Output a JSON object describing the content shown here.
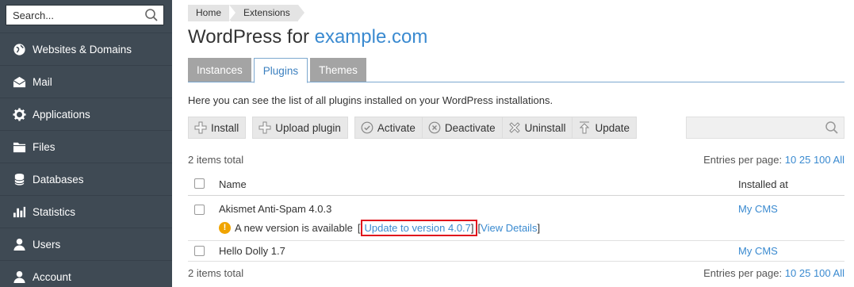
{
  "sidebar": {
    "search_placeholder": "Search...",
    "items": [
      {
        "label": "Websites & Domains",
        "icon": "globe-icon"
      },
      {
        "label": "Mail",
        "icon": "mail-icon"
      },
      {
        "label": "Applications",
        "icon": "gear-icon"
      },
      {
        "label": "Files",
        "icon": "folder-icon"
      },
      {
        "label": "Databases",
        "icon": "database-icon"
      },
      {
        "label": "Statistics",
        "icon": "bar-chart-icon"
      },
      {
        "label": "Users",
        "icon": "user-icon"
      },
      {
        "label": "Account",
        "icon": "account-icon"
      }
    ]
  },
  "breadcrumb": [
    "Home",
    "Extensions"
  ],
  "title": {
    "prefix": "WordPress for ",
    "domain": "example.com"
  },
  "tabs": [
    {
      "label": "Instances",
      "active": false
    },
    {
      "label": "Plugins",
      "active": true
    },
    {
      "label": "Themes",
      "active": false
    }
  ],
  "description": "Here you can see the list of all plugins installed on your WordPress installations.",
  "toolbar": {
    "install": "Install",
    "upload": "Upload plugin",
    "activate": "Activate",
    "deactivate": "Deactivate",
    "uninstall": "Uninstall",
    "update": "Update"
  },
  "list": {
    "total": "2 items total",
    "entries_label": "Entries per page:",
    "entries_options": [
      "10",
      "25",
      "100",
      "All"
    ]
  },
  "table": {
    "col_name": "Name",
    "col_installed": "Installed at",
    "rows": [
      {
        "name": "Akismet Anti-Spam 4.0.3",
        "installed_at": "My CMS",
        "notice_text": "A new version is available",
        "update_link": "Update to version 4.0.7",
        "details_link": "View Details"
      },
      {
        "name": "Hello Dolly 1.7",
        "installed_at": "My CMS"
      }
    ]
  },
  "colors": {
    "sidebar_bg": "#3f4a54",
    "link": "#3a8ad0",
    "highlight": "#e0161d",
    "warning": "#f0a400"
  }
}
